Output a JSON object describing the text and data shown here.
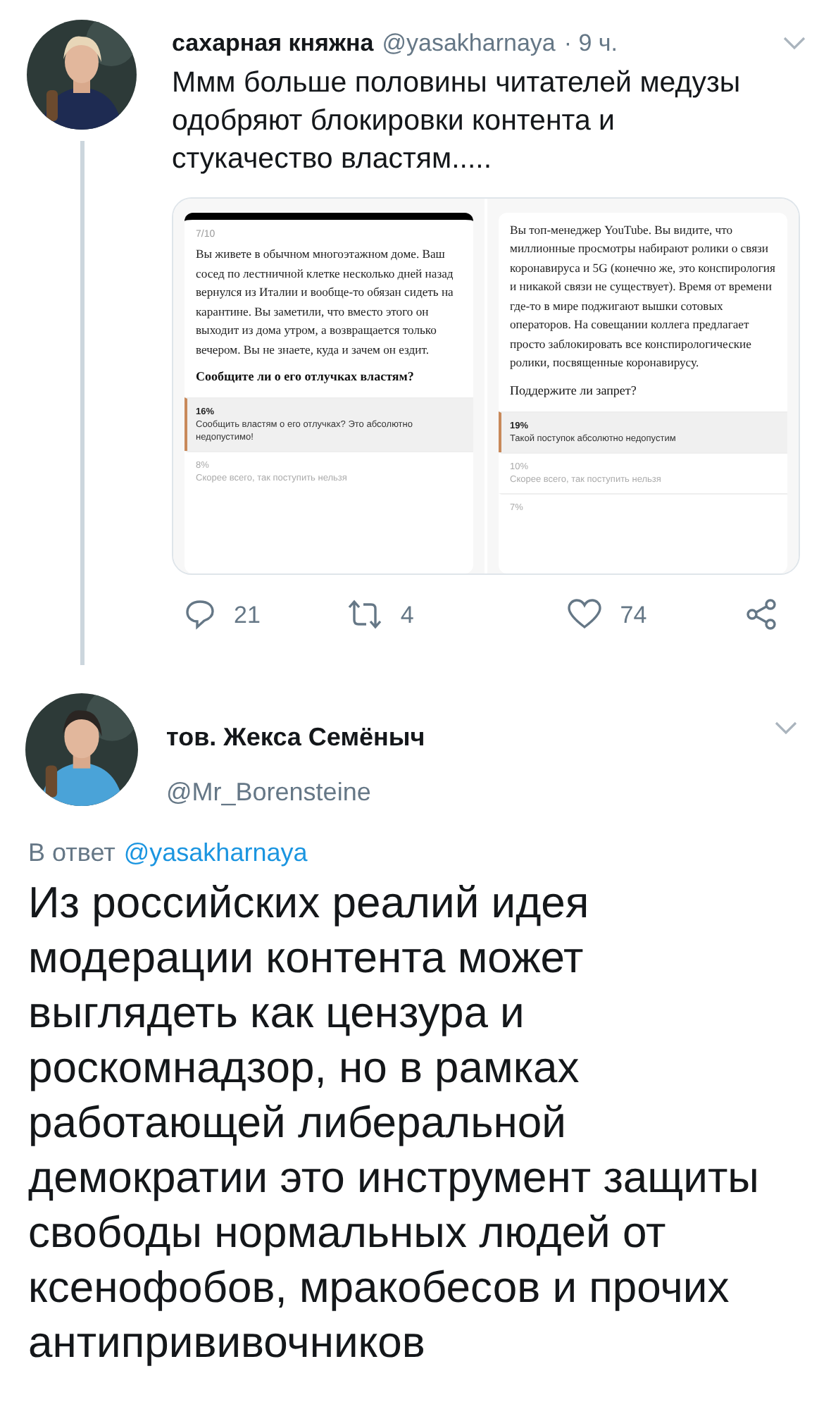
{
  "tweet": {
    "name": "сахарная княжна",
    "handle": "@yasakharnaya",
    "time": "· 9 ч.",
    "text": "Ммм больше половины читателей медузы одобряют блокировки контента и стукачество властям.....",
    "media": [
      {
        "counter": "7/10",
        "body": "Вы живете в обычном многоэтажном доме. Ваш сосед по лестничной клетке несколько дней назад вернулся из Италии и вообще-то обязан сидеть на карантине. Вы заметили, что вместо этого он выходит из дома утром, а возвращается только вечером. Вы не знаете, куда и зачем он ездит.",
        "question": "Сообщите ли о его отлучках властям?",
        "question_bold": true,
        "options": [
          {
            "percent": "16%",
            "label": "Сообщить властям о его отлучках? Это абсолютно недопустимо!",
            "selected": true
          },
          {
            "percent": "8%",
            "label": "Скорее всего, так поступить нельзя",
            "selected": false
          }
        ]
      },
      {
        "body": "Вы топ-менеджер YouTube. Вы видите, что миллионные просмотры набирают ролики о связи коронавируса и 5G (конечно же, это конспирология и никакой связи не существует). Время от времени где-то в мире поджигают вышки сотовых операторов. На совещании коллега предлагает просто заблокировать все конспирологические ролики, посвященные коронавирусу.",
        "question": "Поддержите ли запрет?",
        "question_bold": false,
        "options": [
          {
            "percent": "19%",
            "label": "Такой поступок абсолютно недопустим",
            "selected": true
          },
          {
            "percent": "10%",
            "label": "Скорее всего, так поступить нельзя",
            "selected": false
          },
          {
            "percent": "7%",
            "selected": false
          }
        ]
      }
    ],
    "actions": [
      {
        "kind": "reply",
        "count": "21"
      },
      {
        "kind": "retweet",
        "count": "4"
      },
      {
        "kind": "like",
        "count": "74"
      },
      {
        "kind": "share"
      }
    ]
  },
  "reply": {
    "name": "тов. Жекса Семёныч",
    "handle": "@Mr_Borensteine",
    "reply_prefix": "В ответ",
    "reply_to": "@yasakharnaya",
    "text": "Из российских реалий идея модерации контента может выглядеть как цензура и роскомнадзор, но в рамках работающей либеральной демократии это инструмент защиты свободы нормальных людей от ксенофобов, мракобесов и прочих антипрививочников"
  }
}
